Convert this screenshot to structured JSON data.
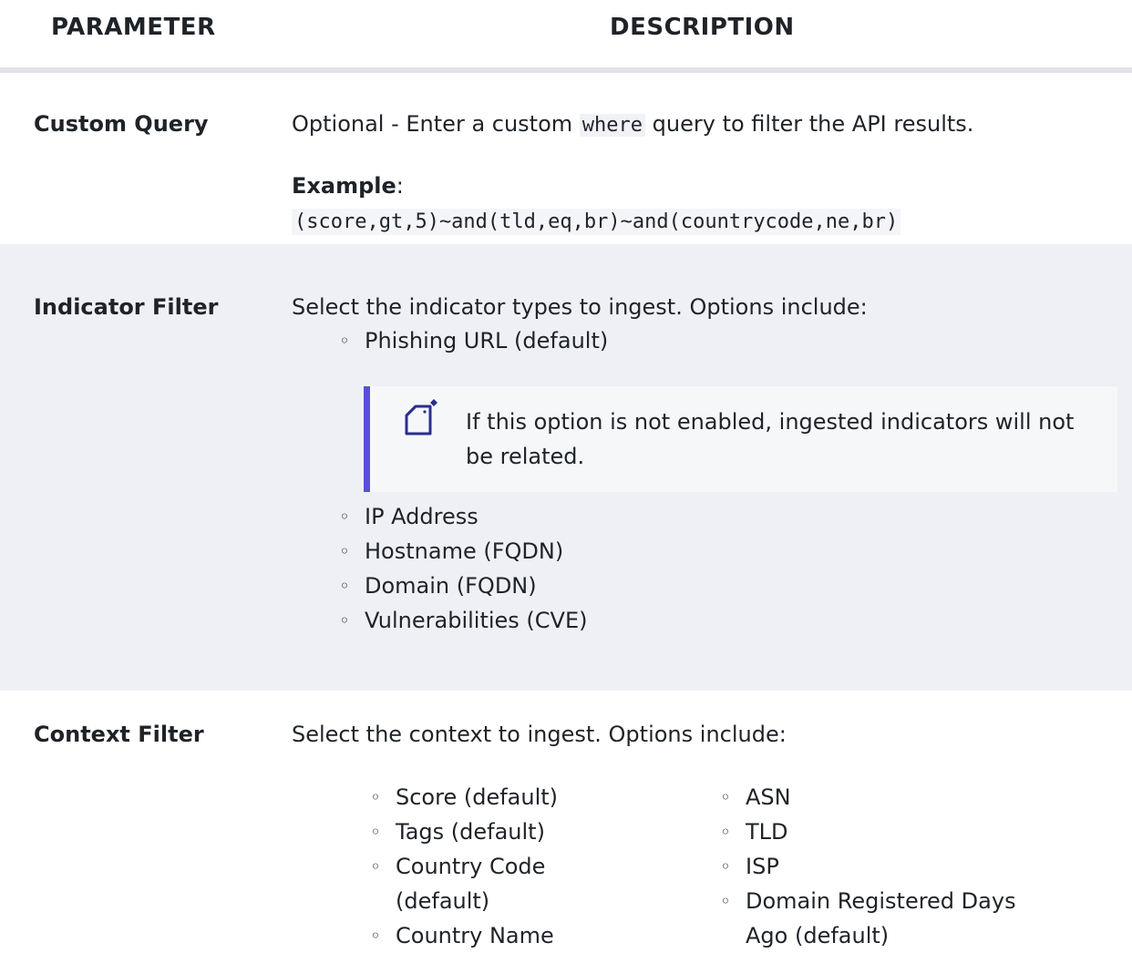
{
  "header": {
    "parameter": "PARAMETER",
    "description": "DESCRIPTION"
  },
  "rows": [
    {
      "name": "Custom Query",
      "desc_prefix": "Optional - Enter a custom",
      "desc_code": "where",
      "desc_suffix": "query to filter the API results.",
      "example_label": "Example",
      "example_code": "(score,gt,5)~and(tld,eq,br)~and(countrycode,ne,br)"
    },
    {
      "name": "Indicator Filter",
      "desc": "Select the indicator types to ingest.  Options include:",
      "options_first": [
        "Phishing URL (default)"
      ],
      "note": "If this option is not enabled, ingested indicators will not be related.",
      "note_icon": "note-icon",
      "options_rest": [
        "IP Address",
        "Hostname (FQDN)",
        "Domain (FQDN)",
        "Vulnerabilities (CVE)"
      ]
    },
    {
      "name": "Context Filter",
      "desc": "Select the context to ingest.  Options include:",
      "options_col1": [
        "Score (default)",
        "Tags (default)",
        "Country Code (default)",
        "Country Name"
      ],
      "options_col2": [
        "ASN",
        "TLD",
        "ISP",
        "Domain Registered Days Ago (default)"
      ]
    }
  ]
}
